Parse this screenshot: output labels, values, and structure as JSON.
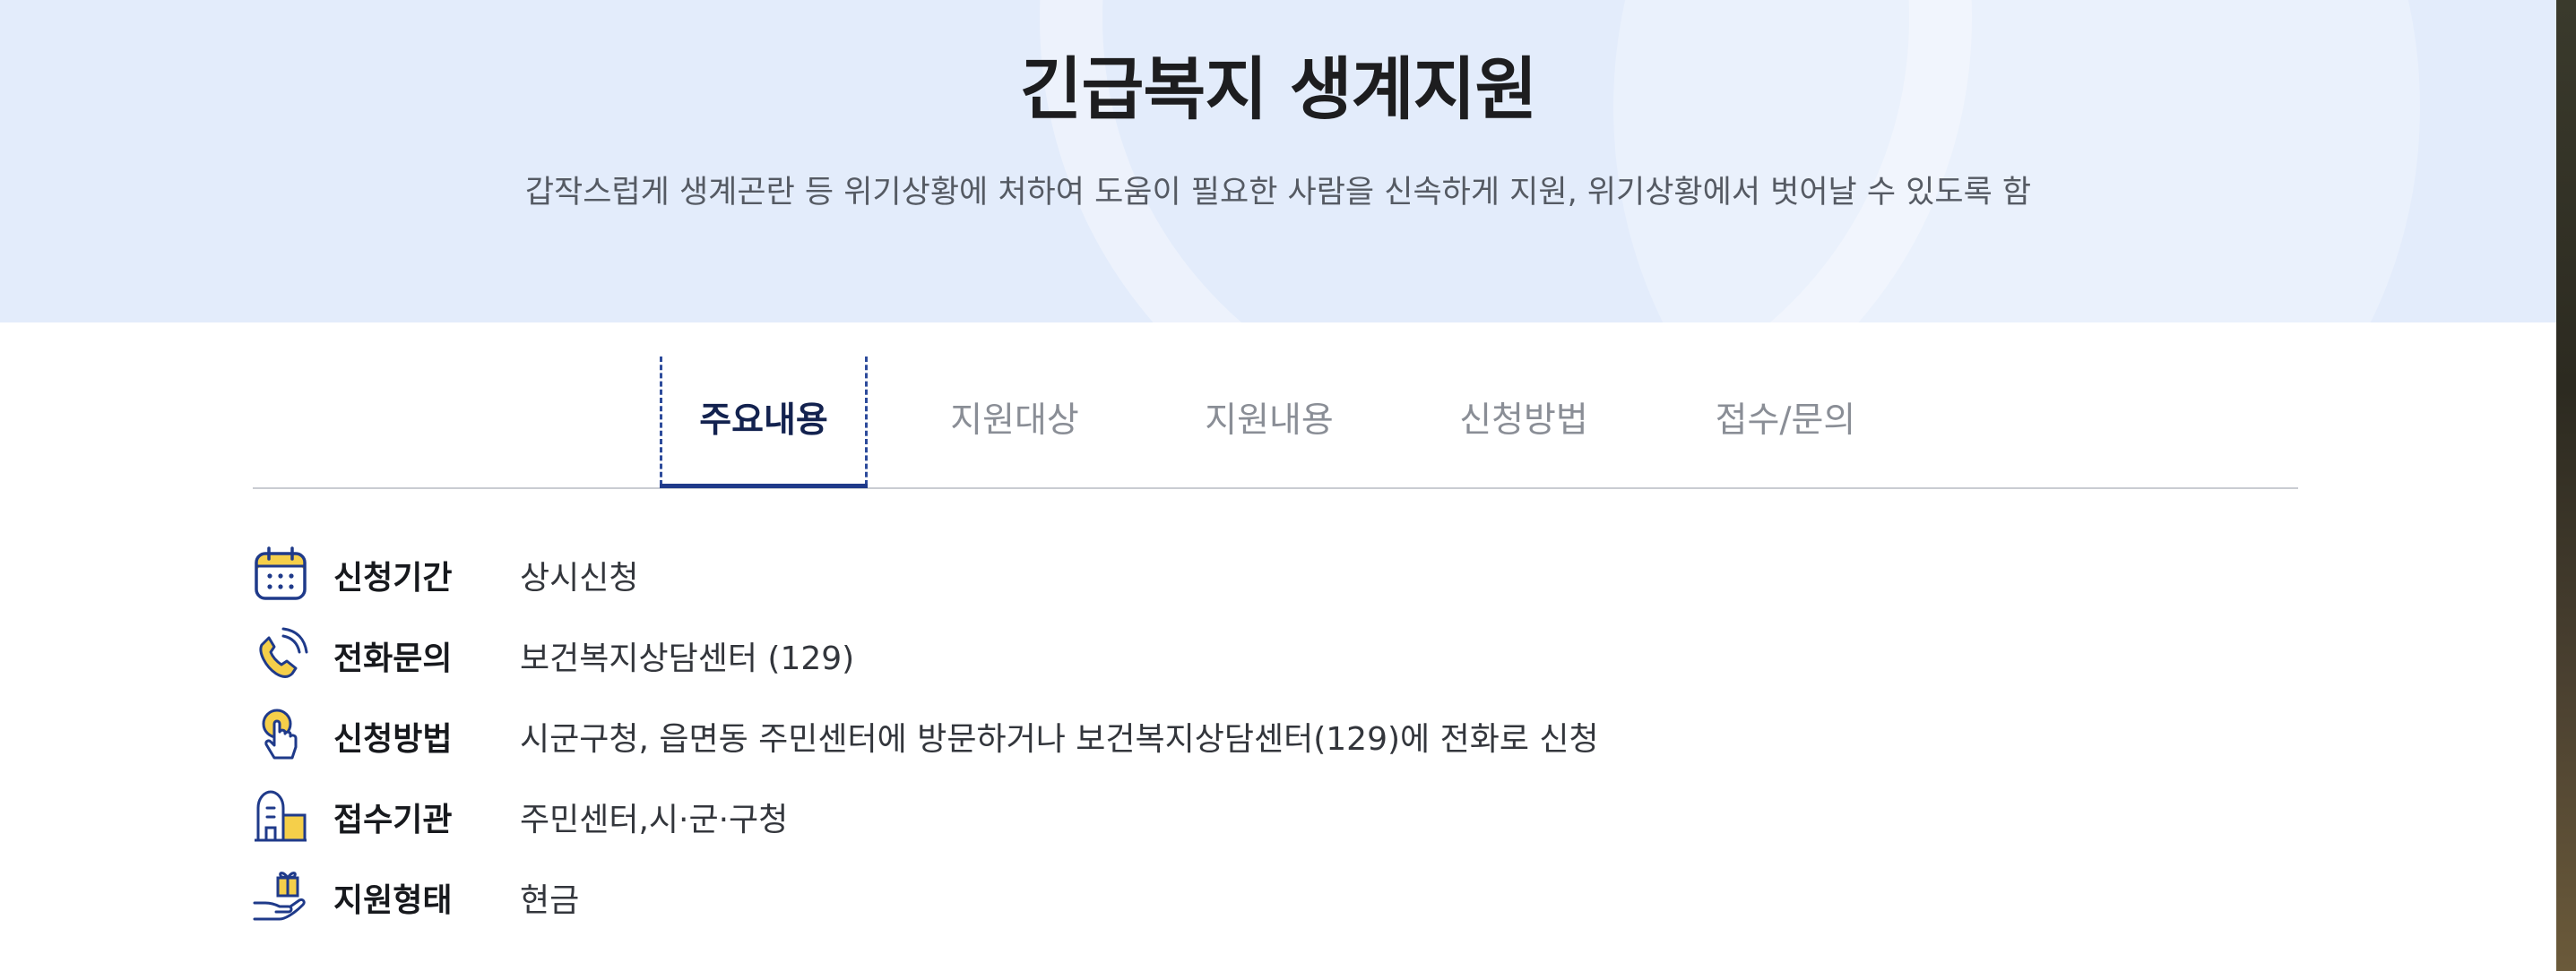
{
  "hero": {
    "title": "긴급복지 생계지원",
    "description": "갑작스럽게 생계곤란 등 위기상황에 처하여 도움이 필요한 사람을 신속하게 지원, 위기상황에서 벗어날 수 있도록 함"
  },
  "tabs": [
    {
      "label": "주요내용",
      "active": true
    },
    {
      "label": "지원대상",
      "active": false
    },
    {
      "label": "지원내용",
      "active": false
    },
    {
      "label": "신청방법",
      "active": false
    },
    {
      "label": "접수/문의",
      "active": false
    }
  ],
  "info": [
    {
      "icon": "calendar-icon",
      "label": "신청기간",
      "value": "상시신청"
    },
    {
      "icon": "phone-icon",
      "label": "전화문의",
      "value": "보건복지상담센터 (129)"
    },
    {
      "icon": "hand-pointer-icon",
      "label": "신청방법",
      "value": "시군구청, 읍면동 주민센터에 방문하거나 보건복지상담센터(129)에 전화로 신청"
    },
    {
      "icon": "building-icon",
      "label": "접수기관",
      "value": "주민센터,시·군·구청"
    },
    {
      "icon": "gift-hand-icon",
      "label": "지원형태",
      "value": "현금"
    }
  ],
  "colors": {
    "hero_bg": "#e3ecfb",
    "accent_navy": "#1f3a8a",
    "icon_yellow": "#f5cf4a"
  }
}
